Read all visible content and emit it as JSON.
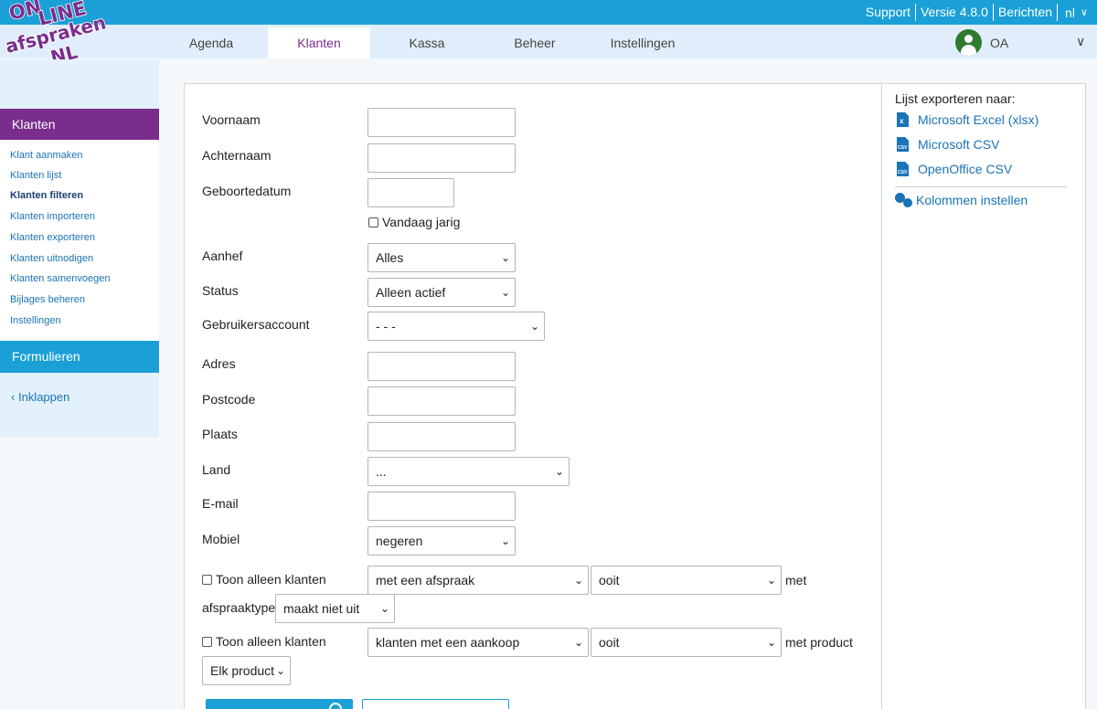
{
  "header": {
    "links": [
      "Support",
      "Versie 4.8.0",
      "Berichten"
    ],
    "language": "nl",
    "language_chevron": "chevron-down-icon"
  },
  "logo": {
    "lines": [
      "ON",
      "LINE",
      "afspraken",
      ".NL"
    ],
    "colors": {
      "fill": "#7a2d8c",
      "outline": "#ffffff"
    }
  },
  "nav": {
    "tabs": [
      "Agenda",
      "Klanten",
      "Kassa",
      "Beheer",
      "Instellingen"
    ],
    "active_tab": "Klanten",
    "user_initials": "OA",
    "user_chevron": "chevron-down-icon"
  },
  "sidebar": {
    "section_title": "Klanten",
    "items": [
      "Klant aanmaken",
      "Klanten lijst",
      "Klanten filteren",
      "Klanten importeren",
      "Klanten exporteren",
      "Klanten uitnodigen",
      "Klanten samenvoegen",
      "Bijlages beheren",
      "Instellingen"
    ],
    "active_item": "Klanten filteren",
    "forms_title": "Formulieren",
    "collapse_label": "Inklappen",
    "collapse_icon": "chevron-left-icon"
  },
  "filter": {
    "voornaam_label": "Voornaam",
    "voornaam_value": "",
    "achternaam_label": "Achternaam",
    "achternaam_value": "",
    "geboortedatum_label": "Geboortedatum",
    "geboortedatum_value": "",
    "vandaag_jarig_label": "Vandaag jarig",
    "aanhef_label": "Aanhef",
    "aanhef_value": "Alles",
    "status_label": "Status",
    "status_value": "Alleen actief",
    "gebruikersaccount_label": "Gebruikersaccount",
    "gebruikersaccount_value": "- - -",
    "adres_label": "Adres",
    "postcode_label": "Postcode",
    "plaats_label": "Plaats",
    "land_label": "Land",
    "land_value": "...",
    "email_label": "E-mail",
    "mobiel_label": "Mobiel",
    "mobiel_value": "negeren",
    "toon_label_1": "Toon alleen klanten",
    "afspraak_value": "met een afspraak",
    "ooit_value_1": "ooit",
    "met_label": "met",
    "afspraaktype_label": "afspraaktype",
    "afspraaktype_value": "maakt niet uit",
    "toon_label_2": "Toon alleen klanten",
    "aankoop_value": "klanten met een aankoop",
    "ooit_value_2": "ooit",
    "met_product_label": "met product",
    "product_value": "Elk product"
  },
  "export": {
    "title": "Lijst exporteren naar:",
    "excel_label": "Microsoft Excel (xlsx)",
    "csv_label": "Microsoft CSV",
    "ooo_label": "OpenOffice CSV",
    "columns_label": "Kolommen instellen"
  },
  "colors": {
    "topbar": "#1aa0d6",
    "nav_bg": "#dfeefa",
    "accent_purple": "#7a2d8c",
    "link_blue": "#1a73b8"
  }
}
